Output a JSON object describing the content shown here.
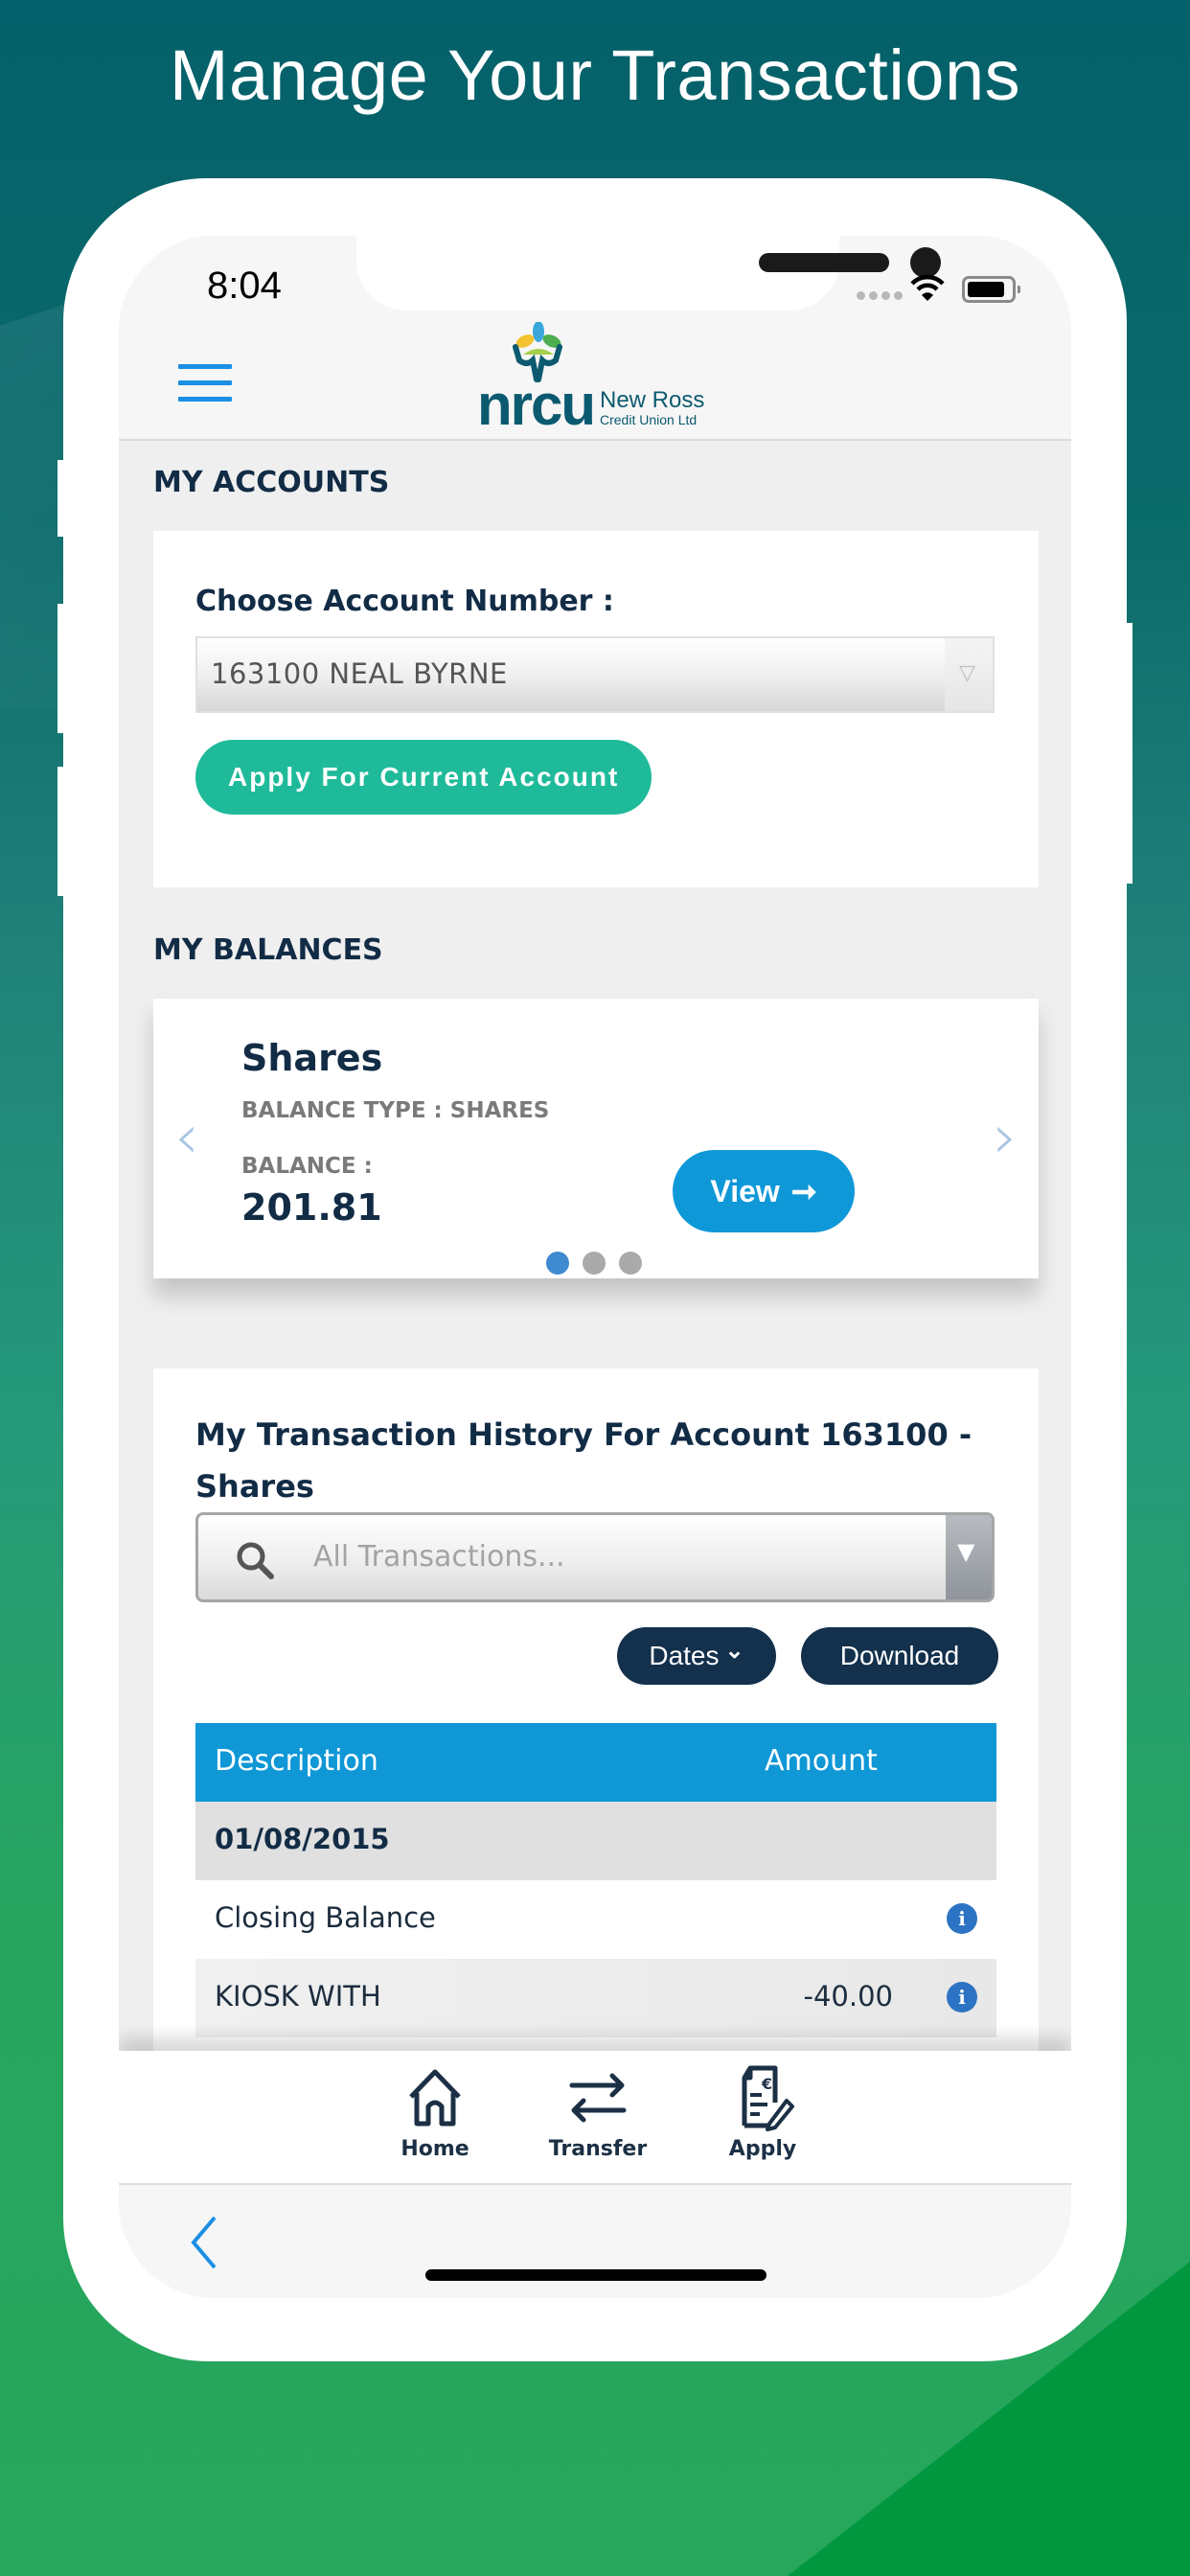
{
  "headline": "Manage Your Transactions",
  "status_bar": {
    "time": "8:04",
    "wifi_icon": "wifi-icon",
    "battery_icon": "battery-icon"
  },
  "header": {
    "menu_icon": "hamburger-menu-icon",
    "logo": {
      "short": "nrcu",
      "name": "New Ross",
      "subtitle": "Credit Union Ltd"
    }
  },
  "my_accounts": {
    "title": "MY ACCOUNTS",
    "choose_label": "Choose Account Number :",
    "selected_account": "163100 NEAL BYRNE",
    "apply_button": "Apply For Current Account"
  },
  "my_balances": {
    "title": "MY BALANCES",
    "card": {
      "name": "Shares",
      "type_label": "BALANCE TYPE : SHARES",
      "balance_label": "BALANCE :",
      "balance_value": "201.81",
      "view_button": "View",
      "view_arrow": "➞"
    },
    "prev_arrow": "‹",
    "next_arrow": "›",
    "carousel_position": 1,
    "carousel_total": 3
  },
  "transactions": {
    "title": "My Transaction History For Account 163100 - Shares",
    "search_placeholder": "All Transactions...",
    "dates_button": "Dates",
    "dates_chevron": "⌄",
    "download_button": "Download",
    "columns": [
      "Description",
      "Amount"
    ],
    "groups": [
      {
        "date": "01/08/2015",
        "rows": [
          {
            "description": "Closing Balance",
            "amount": ""
          },
          {
            "description": "KIOSK WITH",
            "amount": "-40.00"
          }
        ]
      }
    ],
    "info_glyph": "i"
  },
  "tab_bar": {
    "items": [
      {
        "label": "Home",
        "icon": "home-icon"
      },
      {
        "label": "Transfer",
        "icon": "transfer-icon"
      },
      {
        "label": "Apply",
        "icon": "apply-document-icon"
      }
    ]
  },
  "colors": {
    "primary_navy": "#122c46",
    "teal_button": "#1fba9a",
    "blue_accent": "#0f97d6",
    "brand_teal": "#0c5a70",
    "dark_button": "#13304c"
  }
}
